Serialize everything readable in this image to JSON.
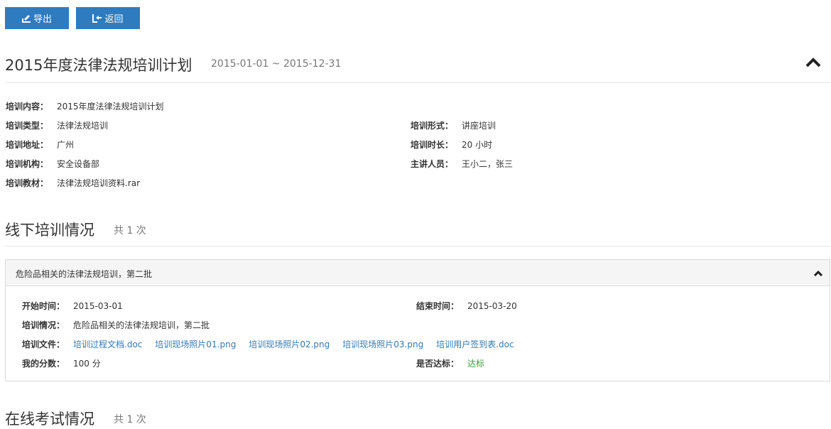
{
  "toolbar": {
    "export_label": "导出",
    "back_label": "返回"
  },
  "plan": {
    "title": "2015年度法律法规培训计划",
    "dates": "2015-01-01 ~ 2015-12-31",
    "fields": {
      "content_key": "培训内容：",
      "content_val": "2015年度法律法规培训计划",
      "type_key": "培训类型：",
      "type_val": "法律法规培训",
      "form_key": "培训形式：",
      "form_val": "讲座培训",
      "address_key": "培训地址：",
      "address_val": "广州",
      "duration_key": "培训时长：",
      "duration_val": "20 小时",
      "org_key": "培训机构：",
      "org_val": "安全设备部",
      "lecturer_key": "主讲人员：",
      "lecturer_val": "王小二，张三",
      "material_key": "培训教材：",
      "material_val": "法律法规培训资料.rar"
    }
  },
  "offline": {
    "title": "线下培训情况",
    "count": "共 1 次",
    "session": {
      "title": "危险品相关的法律法规培训，第二批",
      "start_key": "开始时间：",
      "start_val": "2015-03-01",
      "end_key": "结束时间：",
      "end_val": "2015-03-20",
      "status_key": "培训情况：",
      "status_val": "危险品相关的法律法规培训，第二批",
      "files_key": "培训文件：",
      "files": [
        "培训过程文档.doc",
        "培训现场照片01.png",
        "培训现场照片02.png",
        "培训现场照片03.png",
        "培训用户签到表.doc"
      ],
      "score_key": "我的分数：",
      "score_val": "100 分",
      "pass_key": "是否达标：",
      "pass_val": "达标"
    }
  },
  "online": {
    "title": "在线考试情况",
    "count": "共 1 次"
  },
  "colors": {
    "primary": "#2f7bbf",
    "link": "#337ab7",
    "pass": "#3c9a3c"
  },
  "icons": [
    "export-icon",
    "back-icon",
    "chevron-up-icon"
  ]
}
